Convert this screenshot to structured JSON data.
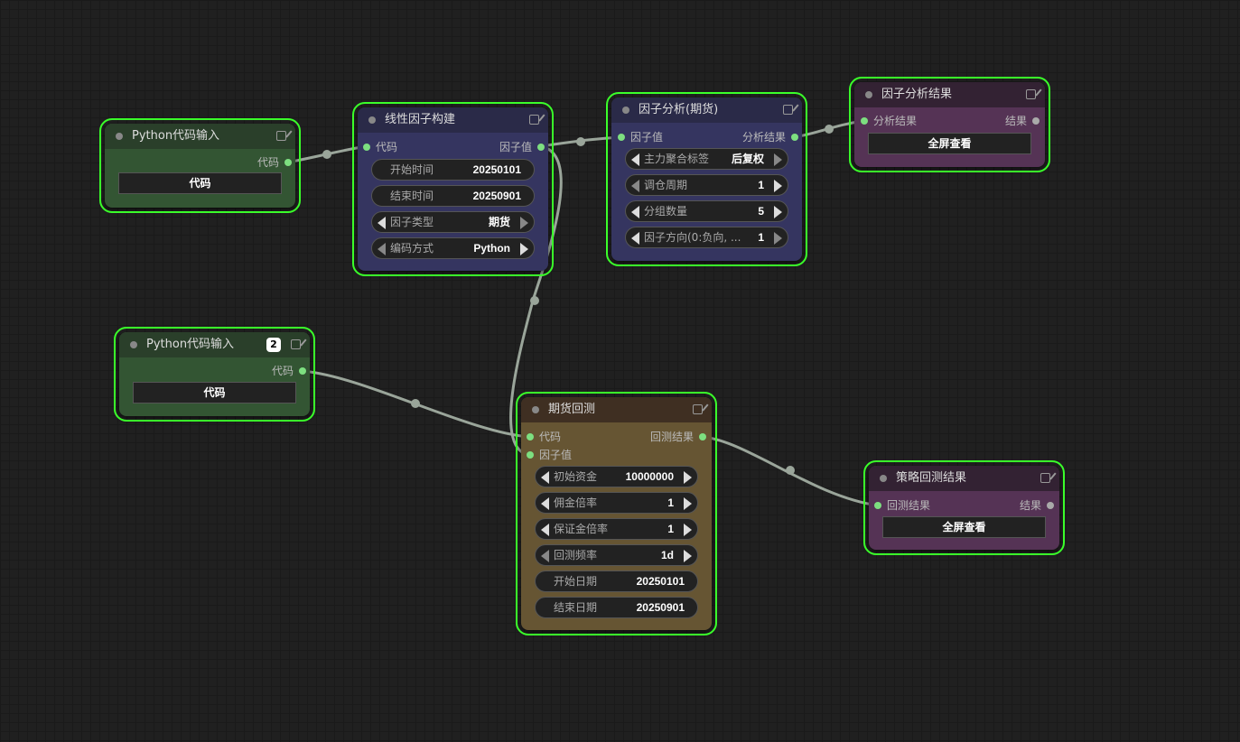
{
  "nodes": {
    "py1": {
      "title": "Python代码输入",
      "out": "代码",
      "button": "代码"
    },
    "py2": {
      "title": "Python代码输入",
      "badge": "2",
      "out": "代码",
      "button": "代码"
    },
    "linear": {
      "title": "线性因子构建",
      "in": "代码",
      "out": "因子值",
      "widgets": [
        {
          "label": "开始时间",
          "value": "20250101"
        },
        {
          "label": "结束时间",
          "value": "20250901"
        },
        {
          "label": "因子类型",
          "value": "期货"
        },
        {
          "label": "编码方式",
          "value": "Python"
        }
      ]
    },
    "analysis": {
      "title": "因子分析(期货)",
      "in": "因子值",
      "out": "分析结果",
      "widgets": [
        {
          "label": "主力聚合标签",
          "value": "后复权"
        },
        {
          "label": "调仓周期",
          "value": "1"
        },
        {
          "label": "分组数量",
          "value": "5"
        },
        {
          "label": "因子方向(0:负向, ...",
          "value": "1"
        }
      ]
    },
    "result": {
      "title": "因子分析结果",
      "in": "分析结果",
      "out": "结果",
      "button": "全屏查看"
    },
    "backtest": {
      "title": "期货回测",
      "in1": "代码",
      "in2": "因子值",
      "out": "回测结果",
      "widgets": [
        {
          "label": "初始资金",
          "value": "10000000"
        },
        {
          "label": "佣金倍率",
          "value": "1"
        },
        {
          "label": "保证金倍率",
          "value": "1"
        },
        {
          "label": "回测频率",
          "value": "1d"
        },
        {
          "label": "开始日期",
          "value": "20250101"
        },
        {
          "label": "结束日期",
          "value": "20250901"
        }
      ]
    },
    "strategy": {
      "title": "策略回测结果",
      "in": "回测结果",
      "out": "结果",
      "button": "全屏查看"
    }
  },
  "colors": {
    "selection_outline": "#3aff2a",
    "link": "#9aa59a",
    "pin": "#7ddf80",
    "green_node": "#335533",
    "purple_node_body": "#353560",
    "purple_node_title": "#2a2a48",
    "brown_node_body": "#665533",
    "brown_node_title": "#3f2f22",
    "magenta_node_body": "#553355",
    "magenta_node_title": "#332233"
  },
  "icons": [
    "edit-icon",
    "status-dot-icon",
    "arrow-left-icon",
    "arrow-right-icon"
  ]
}
